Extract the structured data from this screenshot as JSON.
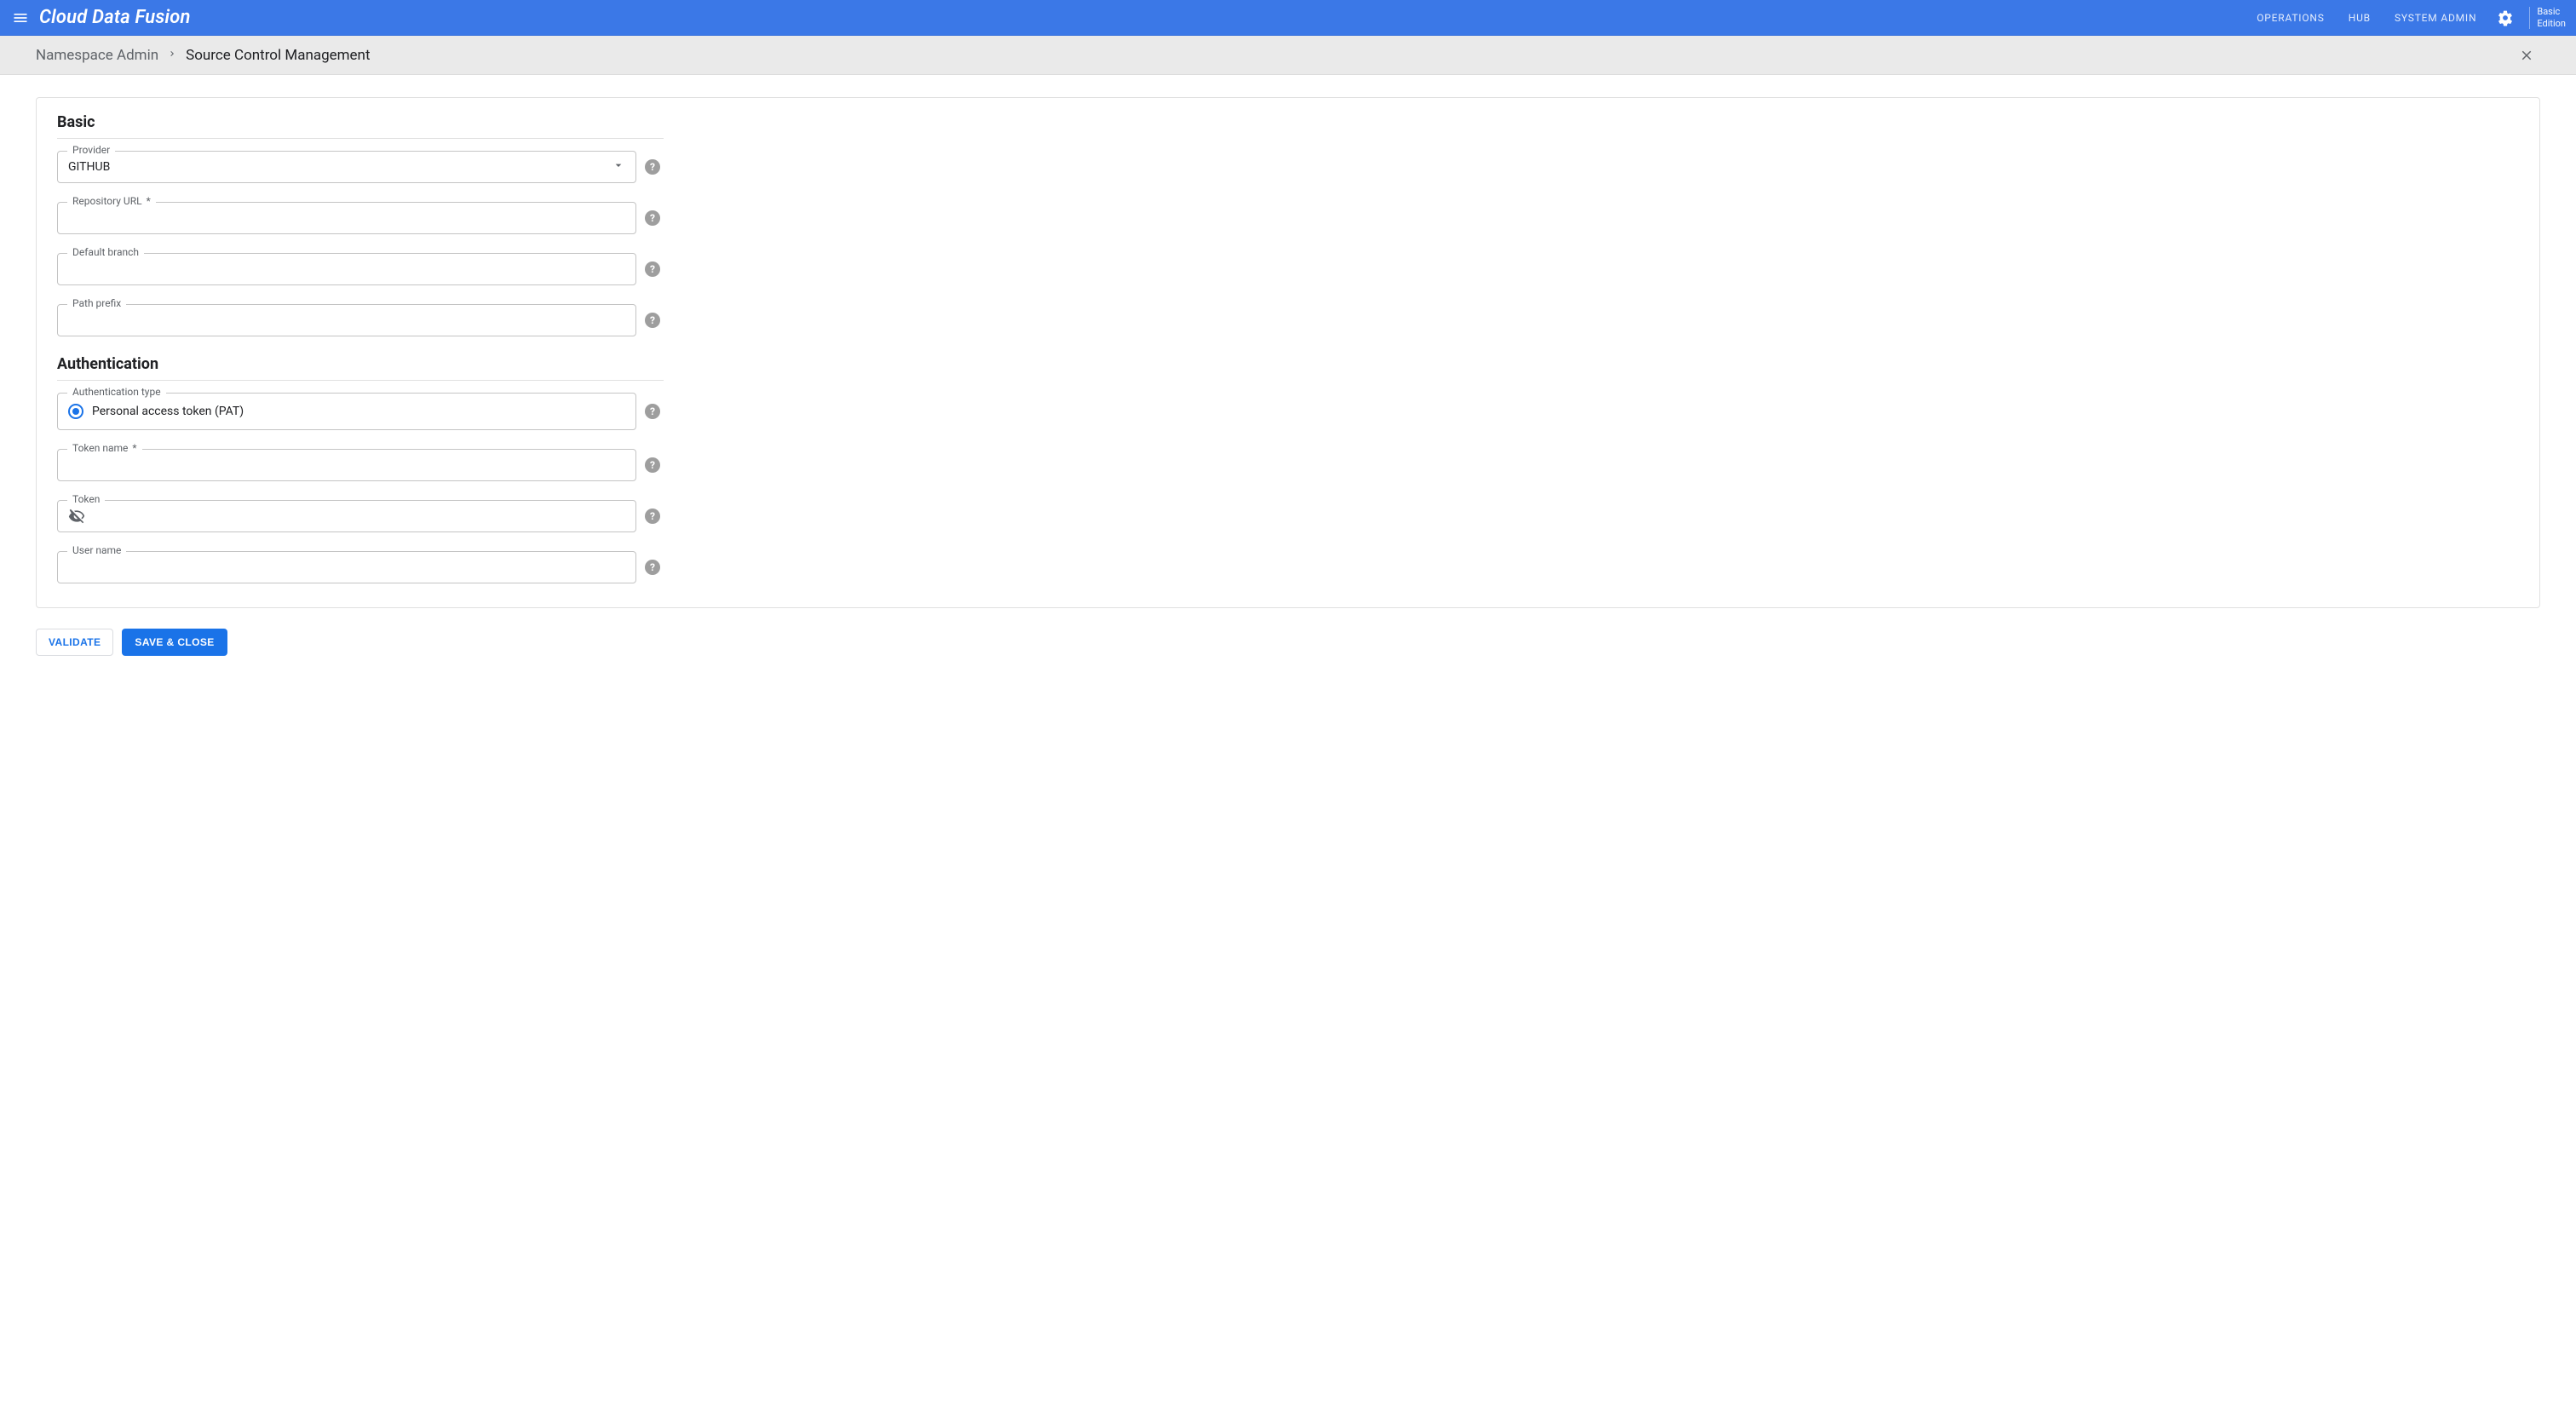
{
  "header": {
    "app_title": "Cloud Data Fusion",
    "nav": {
      "operations": "OPERATIONS",
      "hub": "HUB",
      "system_admin": "SYSTEM ADMIN"
    },
    "edition_line1": "Basic",
    "edition_line2": "Edition"
  },
  "breadcrumb": {
    "parent": "Namespace Admin",
    "current": "Source Control Management"
  },
  "form": {
    "section_basic": "Basic",
    "section_auth": "Authentication",
    "provider": {
      "label": "Provider",
      "value": "GITHUB"
    },
    "repo_url": {
      "label": "Repository URL",
      "required_mark": "*",
      "value": ""
    },
    "default_branch": {
      "label": "Default branch",
      "value": ""
    },
    "path_prefix": {
      "label": "Path prefix",
      "value": ""
    },
    "auth_type": {
      "label": "Authentication type",
      "option_pat": "Personal access token (PAT)"
    },
    "token_name": {
      "label": "Token name",
      "required_mark": "*",
      "value": ""
    },
    "token": {
      "label": "Token",
      "value": ""
    },
    "user_name": {
      "label": "User name",
      "value": ""
    }
  },
  "actions": {
    "validate": "VALIDATE",
    "save_close": "SAVE & CLOSE"
  },
  "help_glyph": "?"
}
